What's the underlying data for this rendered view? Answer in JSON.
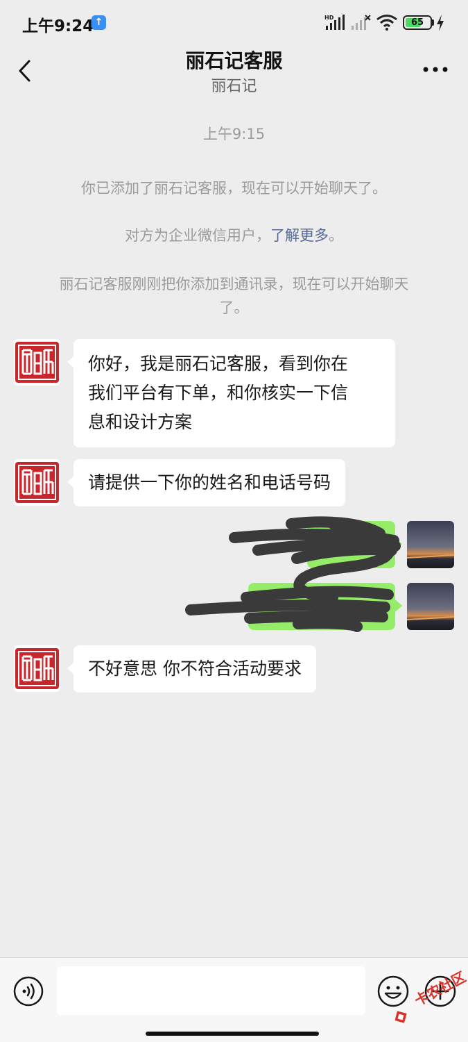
{
  "status": {
    "time": "上午9:24",
    "battery": "65",
    "battery_level": 0.65,
    "icons": [
      "upload-notification-icon",
      "hd-signal-icon",
      "signal-off-icon",
      "wifi-icon",
      "battery-icon",
      "charging-icon"
    ]
  },
  "header": {
    "title": "丽石记客服",
    "subtitle": "丽石记",
    "back_icon": "chevron-left-icon",
    "more_icon": "more-dots-icon"
  },
  "chat": {
    "timestamp": "上午9:15",
    "system_messages": {
      "added": "你已添加了丽石记客服，现在可以开始聊天了。",
      "enterprise_prefix": "对方为企业微信用户，",
      "enterprise_link": "了解更多",
      "enterprise_suffix": "。",
      "contact_line1": "丽石记客服刚刚把你添加到通讯录，现在可以开始聊天",
      "contact_line2": "了。"
    },
    "messages": [
      {
        "side": "left",
        "text": "你好，我是丽石记客服，看到你在我们平台有下单，和你核实一下信息和设计方案",
        "lines": [
          "你好，我是丽石记客服，看到你在",
          "我们平台有下单，和你核实一下信",
          "息和设计方案"
        ]
      },
      {
        "side": "left",
        "text": "请提供一下你的姓名和电话号码"
      },
      {
        "side": "right",
        "text": "",
        "redacted": true
      },
      {
        "side": "right",
        "text": "",
        "redacted": true
      },
      {
        "side": "left",
        "text": "不好意思 你不符合活动要求"
      }
    ],
    "avatar_seal_text": "丽石记"
  },
  "bottom": {
    "input_value": "",
    "voice_icon": "voice-icon",
    "emoji_icon": "emoji-icon",
    "plus_icon": "plus-icon",
    "watermark": "卡农社区"
  },
  "colors": {
    "background": "#ededed",
    "bubble_self": "#95ec69",
    "bubble_other": "#ffffff",
    "link": "#576b95",
    "seal_red": "#c8262a"
  }
}
